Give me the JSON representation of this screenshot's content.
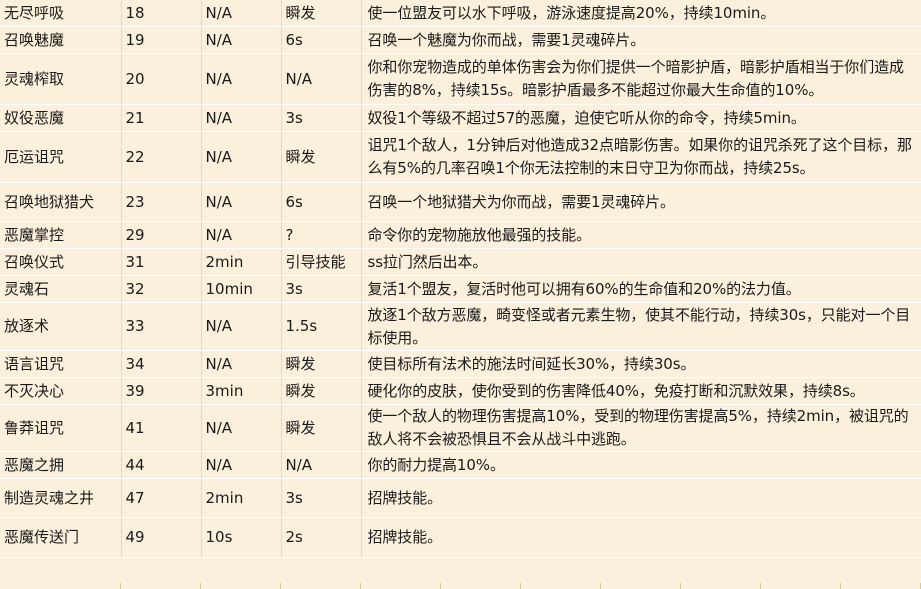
{
  "rows": [
    {
      "name": "无尽呼吸",
      "level": "18",
      "cooldown": "N/A",
      "cast": "瞬发",
      "desc": "使一位盟友可以水下呼吸，游泳速度提高20%，持续10min。"
    },
    {
      "name": "召唤魅魔",
      "level": "19",
      "cooldown": "N/A",
      "cast": "6s",
      "desc": "召唤一个魅魔为你而战，需要1灵魂碎片。"
    },
    {
      "name": "灵魂榨取",
      "level": "20",
      "cooldown": "N/A",
      "cast": "N/A",
      "desc": "你和你宠物造成的单体伤害会为你们提供一个暗影护盾，暗影护盾相当于你们造成伤害的8%，持续15s。暗影护盾最多不能超过你最大生命值的10%。"
    },
    {
      "name": "奴役恶魔",
      "level": "21",
      "cooldown": "N/A",
      "cast": "3s",
      "desc": "奴役1个等级不超过57的恶魔，迫使它听从你的命令，持续5min。"
    },
    {
      "name": "厄运诅咒",
      "level": "22",
      "cooldown": "N/A",
      "cast": "瞬发",
      "desc": "诅咒1个敌人，1分钟后对他造成32点暗影伤害。如果你的诅咒杀死了这个目标，那么有5%的几率召唤1个你无法控制的末日守卫为你而战，持续25s。"
    },
    {
      "name": "召唤地狱猎犬",
      "level": "23",
      "cooldown": "N/A",
      "cast": "6s",
      "desc": "召唤一个地狱猎犬为你而战，需要1灵魂碎片。"
    },
    {
      "name": "恶魔掌控",
      "level": "29",
      "cooldown": "N/A",
      "cast": "?",
      "desc": "命令你的宠物施放他最强的技能。"
    },
    {
      "name": "召唤仪式",
      "level": "31",
      "cooldown": "2min",
      "cast": "引导技能",
      "desc": "ss拉门然后出本。"
    },
    {
      "name": "灵魂石",
      "level": "32",
      "cooldown": "10min",
      "cast": "3s",
      "desc": "复活1个盟友，复活时他可以拥有60%的生命值和20%的法力值。"
    },
    {
      "name": "放逐术",
      "level": "33",
      "cooldown": "N/A",
      "cast": "1.5s",
      "desc": "放逐1个敌方恶魔，畸变怪或者元素生物，使其不能行动，持续30s，只能对一个目标使用。"
    },
    {
      "name": "语言诅咒",
      "level": "34",
      "cooldown": "N/A",
      "cast": "瞬发",
      "desc": "使目标所有法术的施法时间延长30%，持续30s。"
    },
    {
      "name": "不灭决心",
      "level": "39",
      "cooldown": "3min",
      "cast": "瞬发",
      "desc": "硬化你的皮肤，使你受到的伤害降低40%，免疫打断和沉默效果，持续8s。"
    },
    {
      "name": "鲁莽诅咒",
      "level": "41",
      "cooldown": "N/A",
      "cast": "瞬发",
      "desc": "使一个敌人的物理伤害提高10%，受到的物理伤害提高5%，持续2min，被诅咒的敌人将不会被恐惧且不会从战斗中逃跑。"
    },
    {
      "name": "恶魔之拥",
      "level": "44",
      "cooldown": "N/A",
      "cast": "N/A",
      "desc": "你的耐力提高10%。"
    },
    {
      "name": "制造灵魂之井",
      "level": "47",
      "cooldown": "2min",
      "cast": "3s",
      "desc": "招牌技能。"
    },
    {
      "name": "恶魔传送门",
      "level": "49",
      "cooldown": "10s",
      "cast": "2s",
      "desc": "招牌技能。"
    }
  ]
}
